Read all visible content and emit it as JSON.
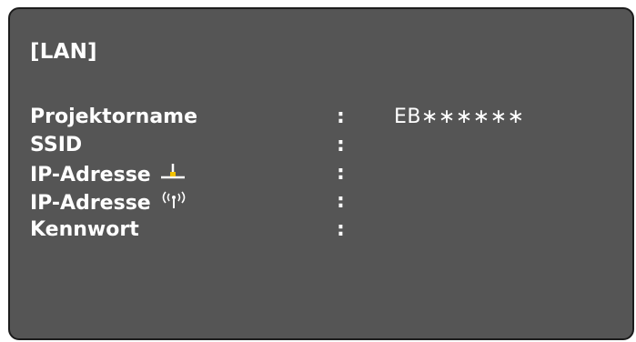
{
  "section_title": "[LAN]",
  "rows": [
    {
      "label": "Projektorname",
      "separator": ":",
      "value": "EB∗∗∗∗∗∗"
    },
    {
      "label": "SSID",
      "separator": ":",
      "value": ""
    },
    {
      "label": "IP-Adresse",
      "icon": "wired-lan-icon",
      "separator": ":",
      "value": ""
    },
    {
      "label": "IP-Adresse",
      "icon": "wireless-lan-icon",
      "separator": ":",
      "value": ""
    },
    {
      "label": "Kennwort",
      "separator": ":",
      "value": ""
    }
  ],
  "colors": {
    "panel_bg": "#555555",
    "text": "#ffffff",
    "wired_icon_accent": "#f2c200"
  }
}
